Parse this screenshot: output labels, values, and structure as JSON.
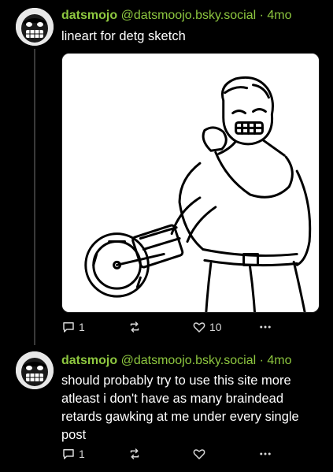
{
  "posts": [
    {
      "author_name": "datsmojo",
      "author_handle": "@datsmoojo.bsky.social",
      "separator": "·",
      "time": "4mo",
      "text": "lineart for detg sketch",
      "reply_count": "1",
      "repost_count": "",
      "like_count": "10",
      "has_image": true
    },
    {
      "author_name": "datsmojo",
      "author_handle": "@datsmoojo.bsky.social",
      "separator": "·",
      "time": "4mo",
      "text": "should probably try to use this site more atleast i don't have as many braindead retards gawking at me under every single post",
      "reply_count": "1",
      "repost_count": "",
      "like_count": ""
    }
  ],
  "icons": {
    "reply": "speech-bubble-icon",
    "repost": "repost-arrows-icon",
    "like": "heart-icon",
    "more": "more-dots-icon"
  },
  "colors": {
    "background": "#000000",
    "accent": "#8dc63f",
    "text": "#ffffff"
  }
}
